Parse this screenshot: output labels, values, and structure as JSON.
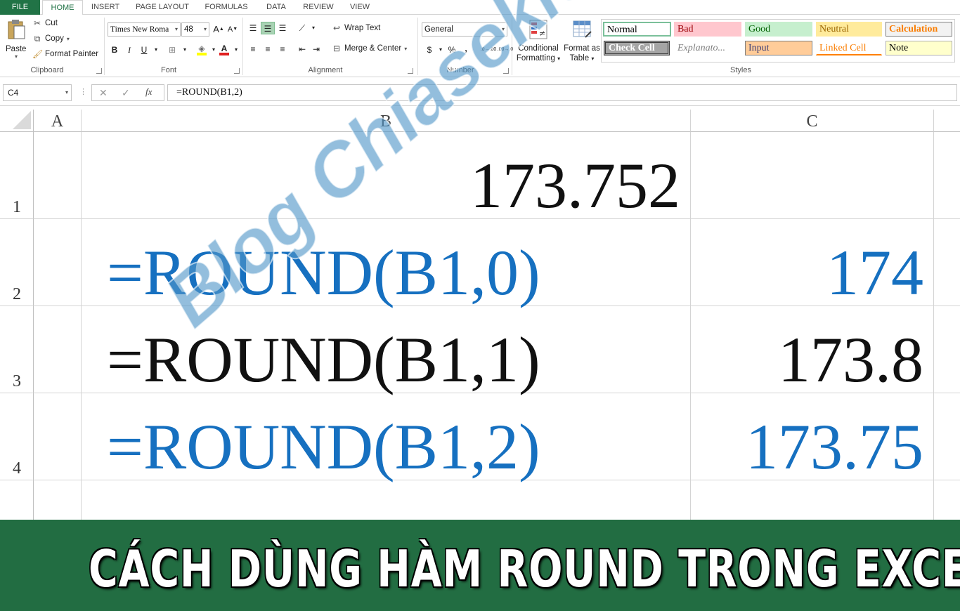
{
  "tabs": [
    "FILE",
    "HOME",
    "INSERT",
    "PAGE LAYOUT",
    "FORMULAS",
    "DATA",
    "REVIEW",
    "VIEW"
  ],
  "clipboard": {
    "paste": "Paste",
    "cut": "Cut",
    "copy": "Copy",
    "format_painter": "Format Painter",
    "label": "Clipboard"
  },
  "font": {
    "name": "Times New Roma",
    "size": "48",
    "label": "Font",
    "bold": "B",
    "italic": "I",
    "underline": "U"
  },
  "alignment": {
    "wrap_text": "Wrap Text",
    "merge_center": "Merge & Center",
    "label": "Alignment"
  },
  "number": {
    "format": "General",
    "currency": "$",
    "percent": "%",
    "comma": ",",
    "inc_decimal": ".0→.00",
    "dec_decimal": ".00→.0",
    "label": "Number"
  },
  "cond_format": {
    "line1": "Conditional",
    "line2": "Formatting"
  },
  "format_table": {
    "line1": "Format as",
    "line2": "Table"
  },
  "styles": {
    "label": "Styles",
    "normal": "Normal",
    "bad": "Bad",
    "good": "Good",
    "neutral": "Neutral",
    "calculation": "Calculation",
    "check_cell": "Check Cell",
    "explanatory": "Explanato...",
    "input": "Input",
    "linked_cell": "Linked Cell",
    "note": "Note"
  },
  "formula_bar": {
    "name_box": "C4",
    "fx": "fx",
    "formula": "=ROUND(B1,2)"
  },
  "columns": [
    "A",
    "B",
    "C"
  ],
  "rows": [
    "1",
    "2",
    "3",
    "4"
  ],
  "cells": {
    "b1": "173.752",
    "b2": "=ROUND(B1,0)",
    "c2": "174",
    "b3": "=ROUND(B1,1)",
    "c3": "173.8",
    "b4": "=ROUND(B1,2)",
    "c4": "173.75"
  },
  "watermark": "Blog Chiasekienthuctinhoc",
  "banner": "CÁCH DÙNG HÀM ROUND TRONG EXCEL",
  "colors": {
    "excel_green": "#217346",
    "banner_green": "#226d42",
    "cell_blue": "#1670c0"
  }
}
